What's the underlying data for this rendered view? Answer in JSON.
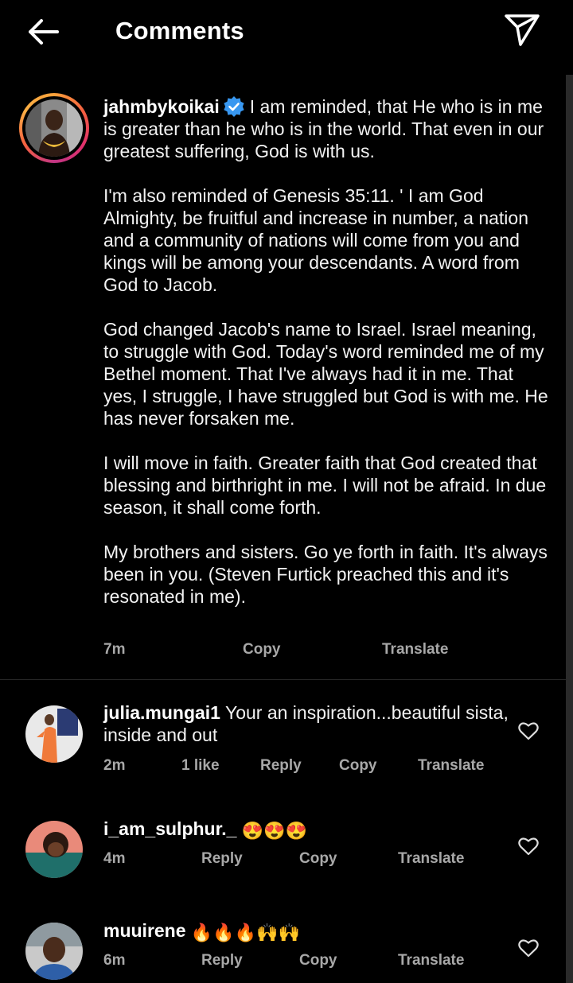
{
  "header": {
    "title": "Comments",
    "back_icon": "arrow-left-icon",
    "share_icon": "paper-plane-icon"
  },
  "caption": {
    "username": "jahmbykoikai",
    "verified": true,
    "paragraphs": [
      "I am reminded, that He who is in me is greater than he who is in the world. That even in our greatest suffering, God is with us.",
      "I'm also reminded of Genesis 35:11. ' I am God Almighty, be fruitful and increase in number, a nation and a community of nations will come from you and kings will be among your descendants. A word from God to Jacob.",
      "God changed Jacob's name to Israel. Israel meaning, to struggle with God. Today's word reminded me of my Bethel moment. That I've always had it in me. That yes, I struggle, I have struggled but God is with me. He has never forsaken me.",
      "I will move in faith. Greater faith that God created that blessing and birthright in me. I will not be afraid. In due season, it shall come forth.",
      "My brothers and sisters. Go ye forth in faith. It's always been in you. (Steven Furtick preached this and it's resonated in me)."
    ],
    "time": "7m",
    "copy_label": "Copy",
    "translate_label": "Translate"
  },
  "comments": [
    {
      "username": "julia.mungai1",
      "text": "Your an inspiration...beautiful sista, inside and out",
      "time": "2m",
      "likes": "1 like",
      "reply_label": "Reply",
      "copy_label": "Copy",
      "translate_label": "Translate"
    },
    {
      "username": "i_am_sulphur._",
      "text": "😍😍😍",
      "time": "4m",
      "reply_label": "Reply",
      "copy_label": "Copy",
      "translate_label": "Translate"
    },
    {
      "username": "muuirene",
      "text": "🔥🔥🔥🙌🙌",
      "time": "6m",
      "reply_label": "Reply",
      "copy_label": "Copy",
      "translate_label": "Translate"
    }
  ],
  "colors": {
    "background": "#000000",
    "text": "#f2f2f2",
    "meta": "#a8a8a8",
    "verified": "#3897f0"
  }
}
